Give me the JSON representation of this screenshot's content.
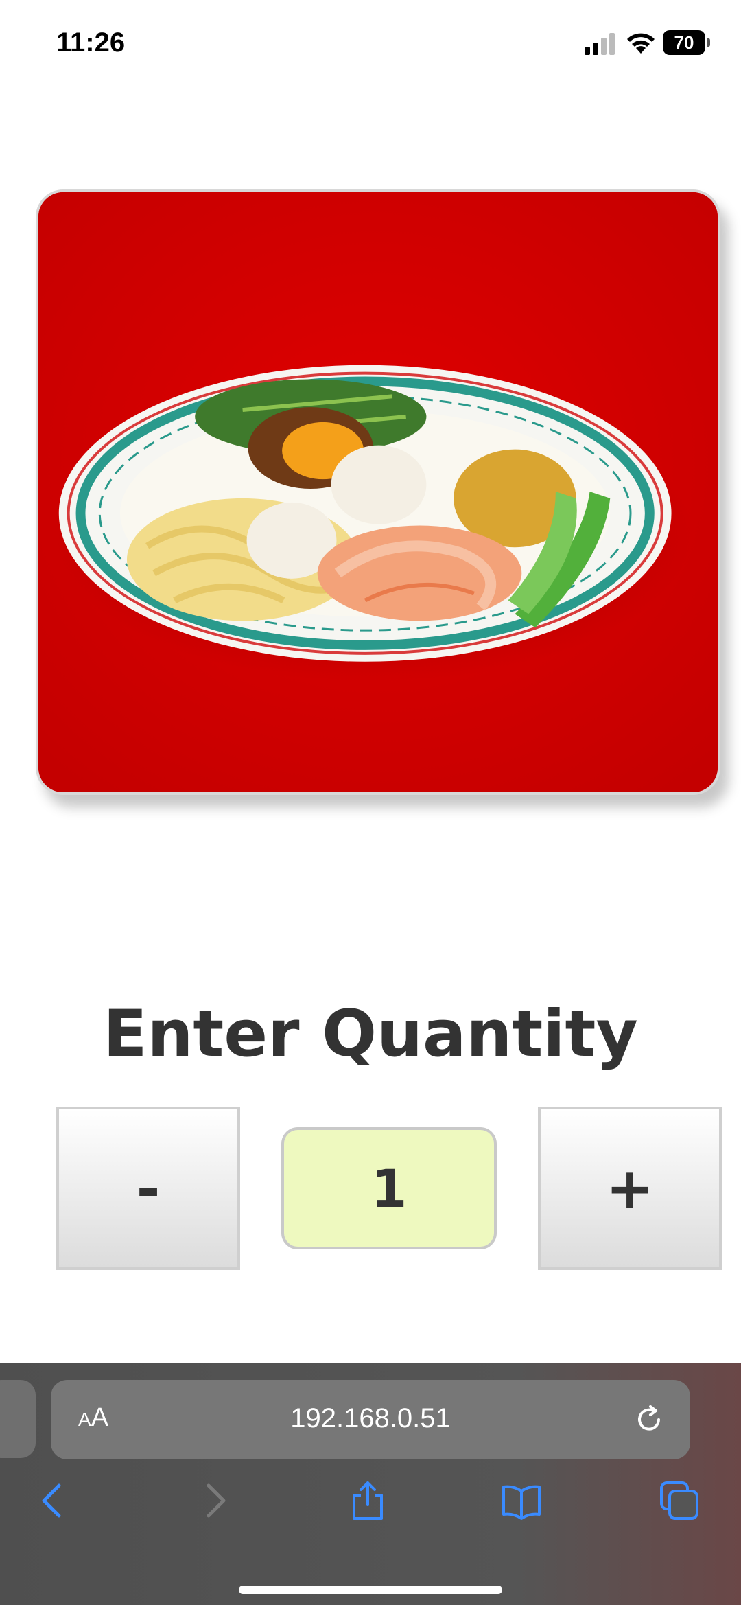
{
  "status_bar": {
    "time": "11:26",
    "battery_level": "70",
    "icons": [
      "cellular-signal-icon",
      "wifi-icon",
      "battery-icon"
    ]
  },
  "product_image": {
    "description_icon": "food-photo",
    "background_color": "#d60000"
  },
  "quantity": {
    "heading": "Enter Quantity",
    "decrement_label": "-",
    "value": "1",
    "increment_label": "+",
    "value_bg_color": "#eef9bf"
  },
  "browser": {
    "text_size_label_small": "A",
    "text_size_label_large": "A",
    "url": "192.168.0.51",
    "toolbar": [
      "back-icon",
      "forward-icon",
      "share-icon",
      "bookmarks-icon",
      "tabs-icon"
    ],
    "accent_color": "#3a8bff"
  }
}
